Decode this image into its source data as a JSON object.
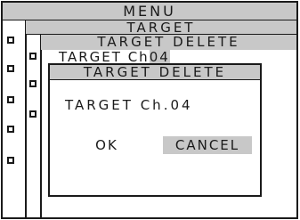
{
  "menu": {
    "title": "MENU"
  },
  "target_menu": {
    "title": "TARGET"
  },
  "target_delete_menu": {
    "title": "TARGET DELETE",
    "item_label": "TARGET Ch",
    "item_channel": "04"
  },
  "dialog": {
    "title": "TARGET DELETE",
    "message": "TARGET Ch.04",
    "ok_label": "OK",
    "cancel_label": "CANCEL",
    "selected": "CANCEL"
  },
  "colors": {
    "highlight": "#c8c8c8",
    "border": "#1a1a1a",
    "background": "#ffffff"
  }
}
